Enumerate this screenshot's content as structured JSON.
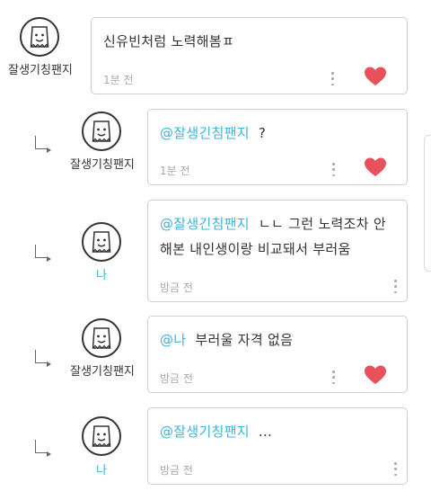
{
  "comments": [
    {
      "author": "잘생기칭팬지",
      "mention": "",
      "text": "신유빈처럼 노력해봄ㅍ",
      "time": "1분 전",
      "liked": true,
      "is_me": false
    },
    {
      "author": "잘생기칭팬지",
      "mention": "@잘생긴침팬지",
      "text": "?",
      "time": "1분 전",
      "liked": true,
      "is_me": false
    },
    {
      "author": "나",
      "mention": "@잘생긴침팬지",
      "text": "ㄴㄴ 그런 노력조차 안해본 내인생이랑 비교돼서 부러움",
      "time": "방금 전",
      "liked": false,
      "is_me": true
    },
    {
      "author": "잘생기칭팬지",
      "mention": "@나",
      "text": "부러울 자격 없음",
      "time": "방금 전",
      "liked": true,
      "is_me": false
    },
    {
      "author": "나",
      "mention": "@잘생기칭팬지",
      "text": "...",
      "time": "방금 전",
      "liked": false,
      "is_me": true
    }
  ],
  "colors": {
    "accent": "#3db4d8",
    "heart": "#e8505b",
    "border": "#cfcfcf",
    "muted": "#aaaaaa"
  },
  "icons": {
    "reply": "reply-arrow-icon",
    "avatar": "bag-face-avatar-icon",
    "more": "more-vertical-icon",
    "like": "heart-icon"
  }
}
